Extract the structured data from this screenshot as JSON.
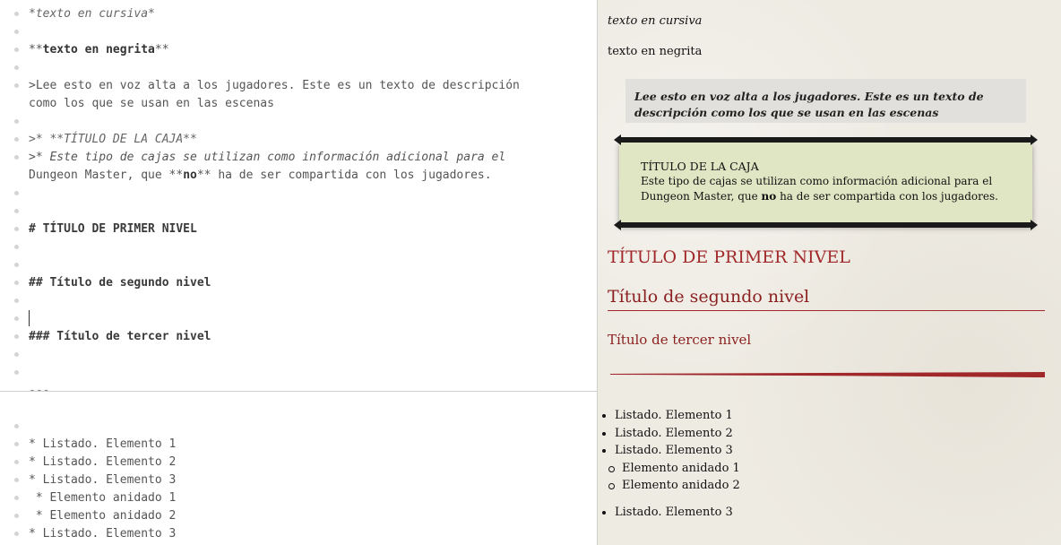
{
  "editor": {
    "lines": {
      "italic": "*texto en cursiva*",
      "bold_prefix": "**",
      "bold_text": "texto en negrita",
      "bold_suffix": "**",
      "read1": ">Lee esto en voz alta a los jugadores. Este es un texto de descripción",
      "read2": "como los que se usan en las escenas",
      "box_title": ">* **TÍTULO DE LA CAJA**",
      "box_body1": ">* Este tipo de cajas se utilizan como información adicional para el",
      "box_body2_a": "Dungeon Master, que **",
      "box_body2_b": "no",
      "box_body2_c": "** ha de ser compartida con los jugadores.",
      "h1": "# TÍTULO DE PRIMER NIVEL",
      "h2": "## Título de segundo nivel",
      "h3": "### Título de tercer nivel",
      "hr": "---",
      "list1": "* Listado. Elemento 1",
      "list2": "* Listado. Elemento 2",
      "list3": "* Listado. Elemento 3",
      "nested1": " * Elemento anidado 1",
      "nested2": " * Elemento anidado 2",
      "list4": "* Listado. Elemento 3"
    }
  },
  "preview": {
    "italic": "texto en cursiva",
    "bold": "texto en negrita",
    "read_aloud": "Lee esto en voz alta a los jugadores. Este es un texto de descripción como los que se usan en las escenas",
    "box_title": "TÍTULO DE LA CAJA",
    "box_body_a": "Este tipo de cajas se utilizan como información adicional para el Dungeon Master, que ",
    "box_body_b": "no",
    "box_body_c": " ha de ser compartida con los jugadores.",
    "h1": "TÍTULO DE PRIMER NIVEL",
    "h2": "Título de segundo nivel",
    "h3": "Título de tercer nivel",
    "list": [
      "Listado. Elemento 1",
      "Listado. Elemento 2",
      "Listado. Elemento 3"
    ],
    "nested": [
      "Elemento anidado 1",
      "Elemento anidado 2"
    ],
    "list_after": "Listado. Elemento 3"
  },
  "colors": {
    "heading_red": "#a1282a",
    "box_background": "#e0e5c3",
    "parchment": "#eeebe3"
  }
}
